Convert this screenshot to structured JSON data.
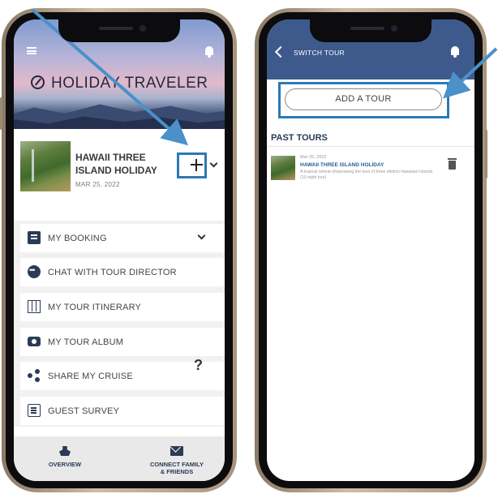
{
  "left_app": {
    "brand": "HOLIDAY TRAVELER",
    "tour": {
      "title_line1": "HAWAII THREE",
      "title_line2": "ISLAND HOLIDAY",
      "date": "MAR 25, 2022"
    },
    "menu": [
      {
        "label": "MY BOOKING",
        "icon": "booking-icon"
      },
      {
        "label": "CHAT WITH TOUR DIRECTOR",
        "icon": "chat-icon"
      },
      {
        "label": "MY TOUR ITINERARY",
        "icon": "map-icon"
      },
      {
        "label": "MY TOUR ALBUM",
        "icon": "camera-icon"
      },
      {
        "label": "SHARE MY CRUISE",
        "icon": "share-icon"
      },
      {
        "label": "GUEST SURVEY",
        "icon": "survey-icon"
      }
    ],
    "help_mark": "?",
    "bottom_nav": {
      "overview": "OVERVIEW",
      "connect_line1": "CONNECT FAMILY",
      "connect_line2": "& FRIENDS"
    }
  },
  "right_app": {
    "topbar_title": "SWITCH TOUR",
    "add_tour_label": "ADD A TOUR",
    "section_title": "PAST TOURS",
    "past_tour": {
      "date": "Mar 25, 2022",
      "title": "HAWAII THREE ISLAND HOLIDAY",
      "description": "A tropical retreat showcasing the best of three distinct Hawaiian Islands (10 night tour)"
    }
  },
  "colors": {
    "navy": "#2a3b55",
    "topbar": "#3e5a8c",
    "highlight": "#2b79b4",
    "arrow": "#4a90c9"
  }
}
